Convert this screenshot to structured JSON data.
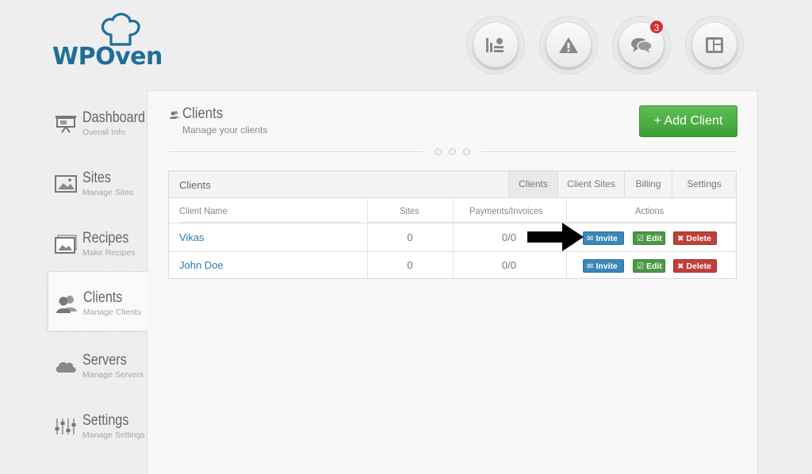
{
  "brand": {
    "name": "WPOven",
    "color": "#1f6e9a"
  },
  "top_buttons": [
    {
      "name": "stats",
      "icon": "stats-icon"
    },
    {
      "name": "alerts",
      "icon": "warning-icon"
    },
    {
      "name": "messages",
      "icon": "chat-icon",
      "badge": "3"
    },
    {
      "name": "layout",
      "icon": "layout-icon"
    }
  ],
  "sidebar": {
    "items": [
      {
        "title": "Dashboard",
        "subtitle": "Overall Info",
        "icon": "presentation-icon"
      },
      {
        "title": "Sites",
        "subtitle": "Manage Sites",
        "icon": "image-icon"
      },
      {
        "title": "Recipes",
        "subtitle": "Make Recipes",
        "icon": "recipe-image-icon"
      },
      {
        "title": "Clients",
        "subtitle": "Manage Clients",
        "icon": "users-icon",
        "active": true
      },
      {
        "title": "Servers",
        "subtitle": "Manage Servers",
        "icon": "cloud-icon"
      },
      {
        "title": "Settings",
        "subtitle": "Manage Settings",
        "icon": "sliders-icon"
      }
    ]
  },
  "page": {
    "title": "Clients",
    "subtitle": "Manage your clients",
    "add_button": "+ Add Client"
  },
  "table": {
    "label": "Clients",
    "tabs": [
      "Clients",
      "Client Sites",
      "Billing",
      "Settings"
    ],
    "active_tab": 0,
    "columns": [
      "Client Name",
      "Sites",
      "Payments/Invoices",
      "Actions"
    ],
    "rows": [
      {
        "name": "Vikas",
        "sites": "0",
        "payments": "0/0"
      },
      {
        "name": "John Doe",
        "sites": "0",
        "payments": "0/0"
      }
    ],
    "actions": {
      "invite": "Invite",
      "edit": "Edit",
      "delete": "Delete"
    }
  },
  "colors": {
    "add_button": "#4cae45",
    "invite": "#3a87b9",
    "edit": "#4a9a44",
    "delete": "#c0403a",
    "link": "#2b7bb9"
  }
}
